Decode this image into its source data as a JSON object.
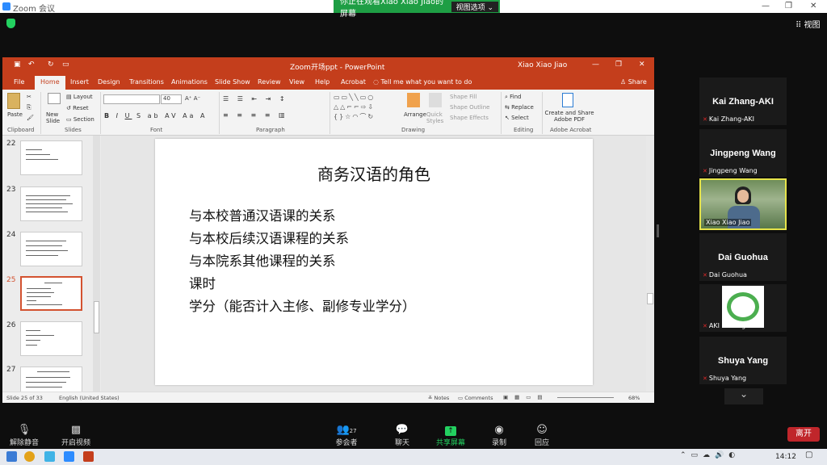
{
  "zoom": {
    "window_title": "Zoom 会议",
    "share_banner": "你正在观看Xiao Xiao Jiao的屏幕",
    "view_options": "视图选项 ⌄",
    "view_button": "视图",
    "colors": {
      "accent": "#1e9e44",
      "leave": "#c0262b",
      "ppt": "#c43e1c"
    }
  },
  "ppt": {
    "file_title": "Zoom开场ppt  -  PowerPoint",
    "user": "Xiao Xiao Jiao",
    "tabs": [
      "File",
      "Home",
      "Insert",
      "Design",
      "Transitions",
      "Animations",
      "Slide Show",
      "Review",
      "View",
      "Help",
      "Acrobat"
    ],
    "tell_me": "Tell me what you want to do",
    "share": "Share",
    "ribbon": {
      "paste": "Paste",
      "new_slide": "New Slide",
      "layout": "Layout",
      "reset": "Reset",
      "section": "Section",
      "font_size": "40",
      "arrange": "Arrange",
      "quick_styles": "Quick Styles",
      "shape_fill": "Shape Fill",
      "shape_outline": "Shape Outline",
      "shape_effects": "Shape Effects",
      "find": "Find",
      "replace": "Replace",
      "select": "Select",
      "create_share": "Create and Share Adobe PDF",
      "groups": [
        "Clipboard",
        "Slides",
        "Font",
        "Paragraph",
        "Drawing",
        "Editing",
        "Adobe Acrobat"
      ]
    },
    "thumbnails": [
      "22",
      "23",
      "24",
      "25",
      "26",
      "27"
    ],
    "slide": {
      "title": "商务汉语的角色",
      "bullets": [
        "与本校普通汉语课的关系",
        "与本校后续汉语课程的关系",
        "与本院系其他课程的关系",
        "课时",
        "学分（能否计入主修、副修专业学分）"
      ]
    },
    "status": {
      "slide_of": "Slide 25 of 33",
      "language": "English (United States)",
      "notes": "Notes",
      "comments": "Comments",
      "zoom": "68%"
    }
  },
  "participants": [
    {
      "name": "Kai Zhang-AKI",
      "label": "Kai Zhang-AKI"
    },
    {
      "name": "Jingpeng Wang",
      "label": "Jingpeng Wang"
    },
    {
      "name": "",
      "label": "Xiao Xiao Jiao"
    },
    {
      "name": "Dai Guohua",
      "label": "Dai Guohua"
    },
    {
      "name": "",
      "label": "AKI Göttingen"
    },
    {
      "name": "Shuya Yang",
      "label": "Shuya Yang"
    }
  ],
  "toolbar": {
    "unmute": "解除静音",
    "start_video": "开启视频",
    "participants": "参会者",
    "participant_count": "27",
    "chat": "聊天",
    "share_screen": "共享屏幕",
    "record": "录制",
    "reactions": "回应",
    "leave": "离开"
  },
  "taskbar": {
    "time": "14:12"
  }
}
